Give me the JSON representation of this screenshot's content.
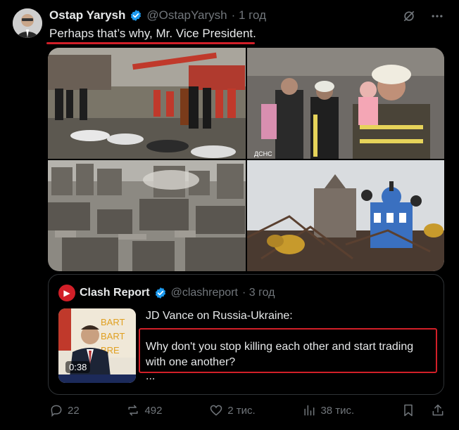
{
  "tweet": {
    "author_name": "Ostap Yarysh",
    "author_handle": "@OstapYarysh",
    "time": "· 1 год",
    "text": "Perhaps that’s why, Mr. Vice President."
  },
  "media": {
    "cells": [
      {
        "icon": "rescue-scene-photo"
      },
      {
        "icon": "firefighter-child-photo",
        "caption": "ДСНС"
      },
      {
        "icon": "destroyed-city-photo"
      },
      {
        "icon": "damaged-church-photo"
      }
    ]
  },
  "quote": {
    "author_name": "Clash Report",
    "author_handle": "@clashreport",
    "time": "· 3 год",
    "headline": "JD Vance on Russia-Ukraine:",
    "body": "Why don't you stop killing each other and start trading with one another?",
    "ellipsis": "...",
    "video_duration": "0:38"
  },
  "actions": {
    "replies": "22",
    "reposts": "492",
    "likes": "2 тис.",
    "views": "38 тис."
  },
  "colors": {
    "background": "#000000",
    "text": "#e7e9ea",
    "muted": "#71767b",
    "verified": "#1d9bf0",
    "highlight_red": "#d21f28"
  }
}
